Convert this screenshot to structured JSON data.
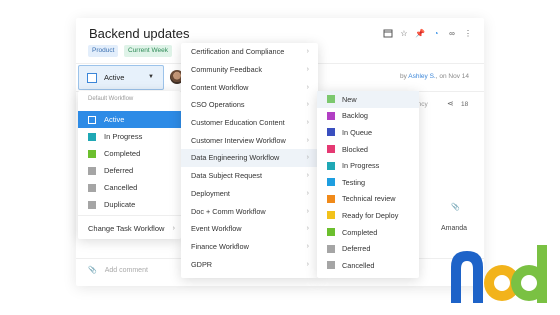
{
  "task": {
    "title": "Backend updates",
    "tags": [
      "Product",
      "Current Week"
    ],
    "meta_author_prefix": "by",
    "meta_author": "Ashley S.",
    "meta_date": ", on Nov 14",
    "meta_partial": "ency",
    "share_count": "18",
    "assignee": "Amanda",
    "add_comment_placeholder": "Add comment"
  },
  "status_button": {
    "label": "Active"
  },
  "workflow_menu": {
    "header": "Default Workflow",
    "items": [
      {
        "label": "Active",
        "color": "#2d8be6",
        "active": true
      },
      {
        "label": "In Progress",
        "color": "#1fa8b5"
      },
      {
        "label": "Completed",
        "color": "#6cbf2e"
      },
      {
        "label": "Deferred",
        "color": "#a5a5a5"
      },
      {
        "label": "Cancelled",
        "color": "#a5a5a5"
      },
      {
        "label": "Duplicate",
        "color": "#a5a5a5"
      }
    ],
    "change_label": "Change Task Workflow"
  },
  "workflow_list": {
    "items": [
      "Certification and Compliance",
      "Community Feedback",
      "Content Workflow",
      "CSO Operations",
      "Customer Education Content",
      "Customer Interview Workflow",
      "Data Engineering Workflow",
      "Data Subject Request",
      "Deployment",
      "Doc + Comm Workflow",
      "Event Workflow",
      "Finance Workflow",
      "GDPR"
    ],
    "hovered": "Data Engineering Workflow"
  },
  "status_list": {
    "items": [
      {
        "label": "New",
        "color": "#7cc86e"
      },
      {
        "label": "Backlog",
        "color": "#b23fc4"
      },
      {
        "label": "In Queue",
        "color": "#3a4fbf"
      },
      {
        "label": "Blocked",
        "color": "#e53973"
      },
      {
        "label": "In Progress",
        "color": "#1fa8b5"
      },
      {
        "label": "Testing",
        "color": "#1e9ee0"
      },
      {
        "label": "Technical review",
        "color": "#f08a1a"
      },
      {
        "label": "Ready for Deploy",
        "color": "#f2c21b"
      },
      {
        "label": "Completed",
        "color": "#6cbf2e"
      },
      {
        "label": "Deferred",
        "color": "#a5a5a5"
      },
      {
        "label": "Cancelled",
        "color": "#a5a5a5"
      }
    ]
  },
  "logo": {
    "text": "nod",
    "colors": [
      "#1e63c8",
      "#f2b31b",
      "#7ac143"
    ]
  }
}
